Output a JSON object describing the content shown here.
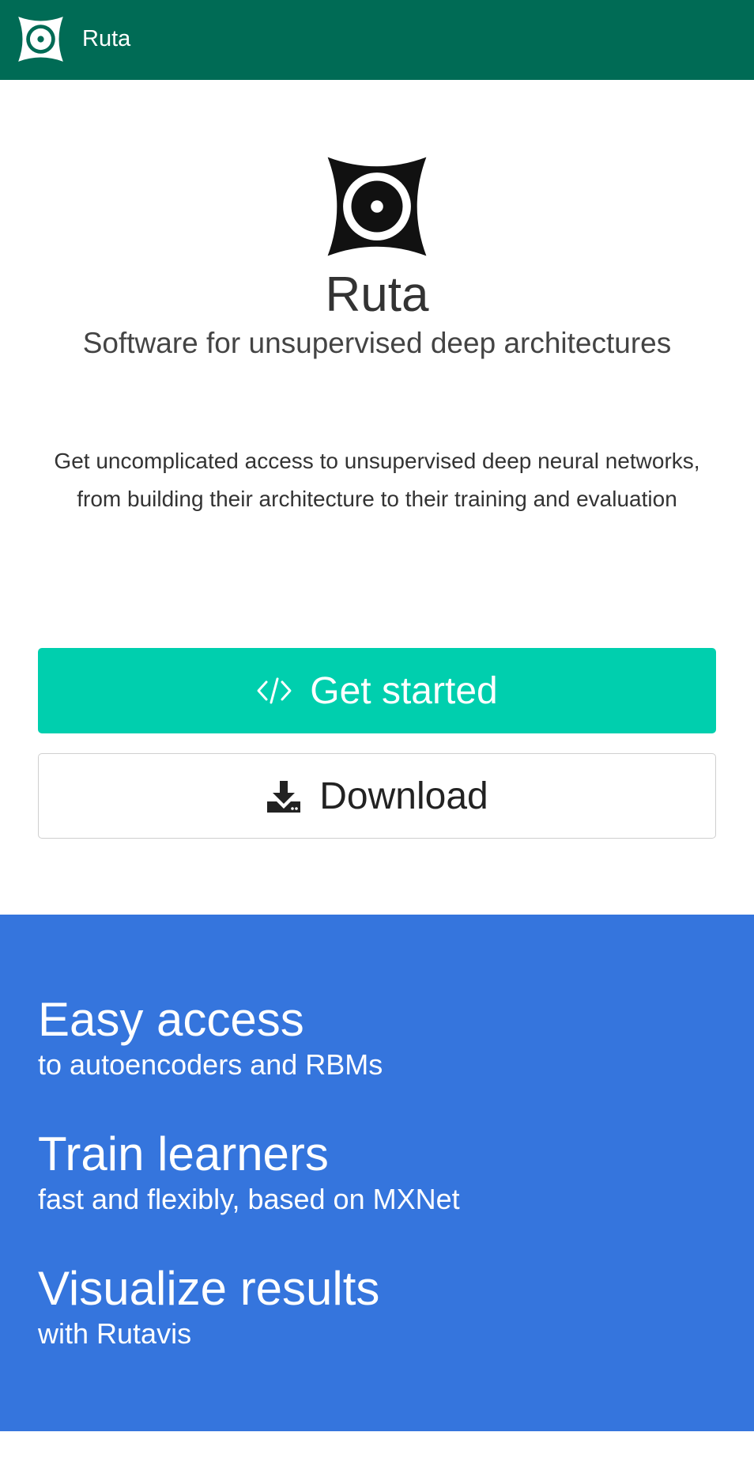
{
  "navbar": {
    "title": "Ruta",
    "logo_icon": "ruta-logo-icon"
  },
  "hero": {
    "logo_icon": "ruta-logo-icon",
    "title": "Ruta",
    "subtitle": "Software for unsupervised deep architectures",
    "description": "Get uncomplicated access to unsupervised deep neural networks, from building their architecture to their training and evaluation"
  },
  "buttons": {
    "get_started": {
      "label": "Get started",
      "icon": "code-icon"
    },
    "download": {
      "label": "Download",
      "icon": "download-icon"
    }
  },
  "features": [
    {
      "title": "Easy access",
      "text": "to autoencoders and RBMs"
    },
    {
      "title": "Train learners",
      "text": "fast and flexibly, based on MXNet"
    },
    {
      "title": "Visualize results",
      "text": "with Rutavis"
    }
  ],
  "colors": {
    "navbar_bg": "#006b55",
    "primary_button": "#00cfae",
    "features_bg": "#3575dd"
  }
}
